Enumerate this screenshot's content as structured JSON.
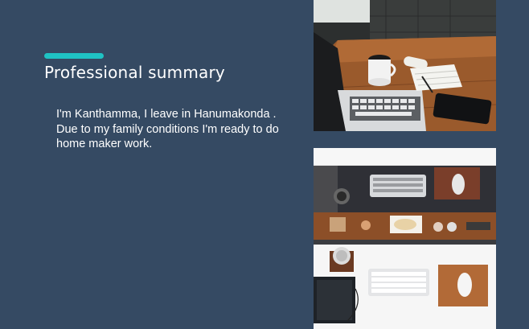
{
  "section": {
    "title": "Professional summary",
    "summary": "I'm Kanthamma, I leave in Hanumakonda . Due to my family conditions I'm ready to do home maker work."
  },
  "colors": {
    "background": "#354a63",
    "accent": "#1fc3c4",
    "text": "#ffffff"
  },
  "images": [
    {
      "subject": "laptop-and-coffee-on-wooden-desk"
    },
    {
      "subject": "top-down-workspace-keyboard-mouse"
    }
  ]
}
